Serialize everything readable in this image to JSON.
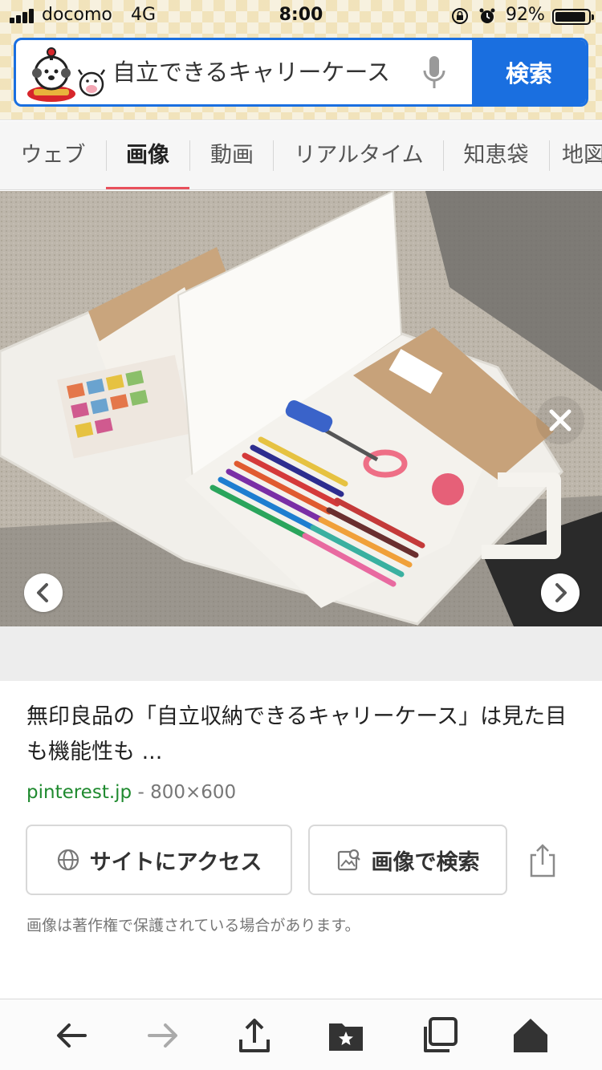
{
  "status_bar": {
    "carrier": "docomo",
    "network": "4G",
    "time": "8:00",
    "battery_percent": "92%",
    "battery_level": 0.92,
    "icons": [
      "signal-icon",
      "orientation-lock-icon",
      "alarm-icon",
      "battery-icon"
    ]
  },
  "search": {
    "query": "自立できるキャリーケース",
    "button_label": "検索",
    "mic_icon": "microphone-icon",
    "mascot_icon": "mascot-logo-icon",
    "accent_color": "#1a6fe0"
  },
  "tabs": [
    {
      "label": "ウェブ",
      "active": false
    },
    {
      "label": "画像",
      "active": true
    },
    {
      "label": "動画",
      "active": false
    },
    {
      "label": "リアルタイム",
      "active": false
    },
    {
      "label": "知恵袋",
      "active": false
    },
    {
      "label": "地図",
      "active": false
    }
  ],
  "tab_active_color": "#e8505b",
  "viewer": {
    "close_icon": "close-icon",
    "prev_icon": "chevron-left-icon",
    "next_icon": "chevron-right-icon"
  },
  "result": {
    "title": "無印良品の「自立収納できるキャリーケース」は見た目も機能性も ...",
    "domain": "pinterest.jp",
    "separator": " - ",
    "dimensions": "800×600",
    "domain_color": "#1f8a2f"
  },
  "actions": {
    "visit_label": "サイトにアクセス",
    "visit_icon": "globe-icon",
    "image_search_label": "画像で検索",
    "image_search_icon": "image-search-icon",
    "share_icon": "share-icon"
  },
  "copyright_notice": "画像は著作権で保護されている場合があります。",
  "toolbar": {
    "icons": [
      "back-arrow-icon",
      "forward-arrow-icon",
      "upload-share-icon",
      "bookmark-folder-icon",
      "tabs-icon",
      "home-icon"
    ]
  }
}
